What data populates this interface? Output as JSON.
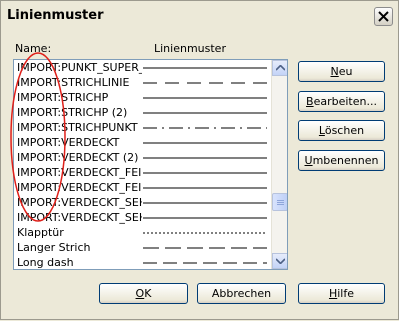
{
  "title": "Linienmuster",
  "header": {
    "name_label": "Name:",
    "pattern_label": "Linienmuster"
  },
  "list": {
    "items": [
      {
        "name": "IMPORT:PUNKT_SUPER_F",
        "dash": "0"
      },
      {
        "name": "IMPORT:STRICHLINIE",
        "dash": "14 8"
      },
      {
        "name": "IMPORT:STRICHP",
        "dash": "0"
      },
      {
        "name": "IMPORT:STRICHP (2)",
        "dash": "0"
      },
      {
        "name": "IMPORT:STRICHPUNKT",
        "dash": "14 5 2 5"
      },
      {
        "name": "IMPORT:VERDECKT",
        "dash": "0"
      },
      {
        "name": "IMPORT:VERDECKT (2)",
        "dash": "0"
      },
      {
        "name": "IMPORT:VERDECKT_FEIN",
        "dash": "0"
      },
      {
        "name": "IMPORT:VERDECKT_FEIN",
        "dash": "0"
      },
      {
        "name": "IMPORT:VERDECKT_SEH",
        "dash": "0"
      },
      {
        "name": "IMPORT:VERDECKT_SEH",
        "dash": "0"
      },
      {
        "name": "Klapptür",
        "dash": "2 2"
      },
      {
        "name": "Langer Strich",
        "dash": "16 6"
      },
      {
        "name": "Long dash",
        "dash": "14 6"
      }
    ]
  },
  "buttons": {
    "neu": {
      "accel": "N",
      "rest": "eu"
    },
    "bearbeiten": {
      "accel": "B",
      "rest": "earbeiten..."
    },
    "loeschen": {
      "accel": "L",
      "rest": "öschen"
    },
    "umbenennen": {
      "accel": "U",
      "rest": "mbenennen"
    },
    "ok": {
      "accel": "O",
      "rest": "K"
    },
    "abbrechen": {
      "label": "Abbrechen"
    },
    "hilfe": {
      "accel": "H",
      "rest": "ilfe"
    }
  },
  "colors": {
    "annotation": "#e0201a",
    "accent_border": "#003c74"
  }
}
